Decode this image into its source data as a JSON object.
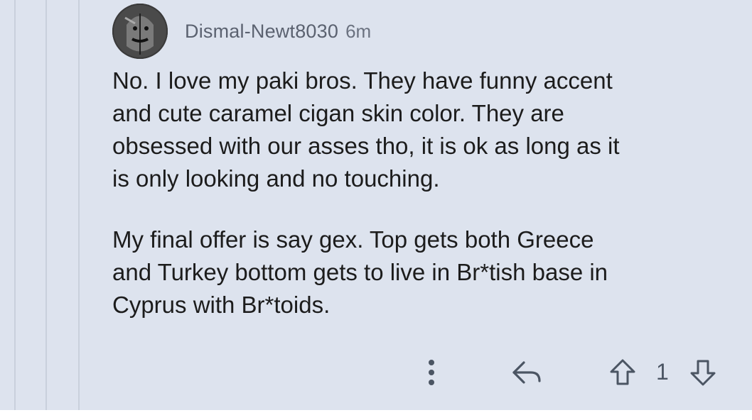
{
  "comment": {
    "author": "Dismal-Newt8030",
    "age": "6m",
    "paragraphs": [
      "No. I love my paki bros. They have funny accent\nand cute caramel cigan skin color. They are\nobsessed with our asses tho, it is ok as long as it\nis only looking and no touching.",
      "My final offer is say gex. Top gets both Greece\nand Turkey bottom gets to live in Br*tish base in\nCyprus with Br*toids."
    ],
    "score": "1"
  },
  "icons": {
    "avatar": "avatar",
    "more": "more-vertical-icon",
    "reply": "reply-icon",
    "upvote": "upvote-icon",
    "downvote": "downvote-icon"
  }
}
